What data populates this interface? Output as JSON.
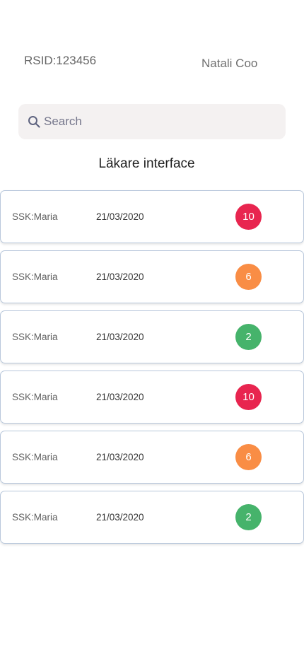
{
  "header": {
    "rsid": "RSID:123456",
    "user_name": "Natali Coo"
  },
  "search": {
    "placeholder": "Search",
    "icon": "search-icon"
  },
  "page_title": "Läkare interface",
  "rows": [
    {
      "name": "SSK:Maria",
      "date": "21/03/2020",
      "count": "10",
      "color": "#e8254f"
    },
    {
      "name": "SSK:Maria",
      "date": "21/03/2020",
      "count": "6",
      "color": "#f98d45"
    },
    {
      "name": "SSK:Maria",
      "date": "21/03/2020",
      "count": "2",
      "color": "#46b36b"
    },
    {
      "name": "SSK:Maria",
      "date": "21/03/2020",
      "count": "10",
      "color": "#e8254f"
    },
    {
      "name": "SSK:Maria",
      "date": "21/03/2020",
      "count": "6",
      "color": "#f98d45"
    },
    {
      "name": "SSK:Maria",
      "date": "21/03/2020",
      "count": "2",
      "color": "#46b36b"
    }
  ]
}
